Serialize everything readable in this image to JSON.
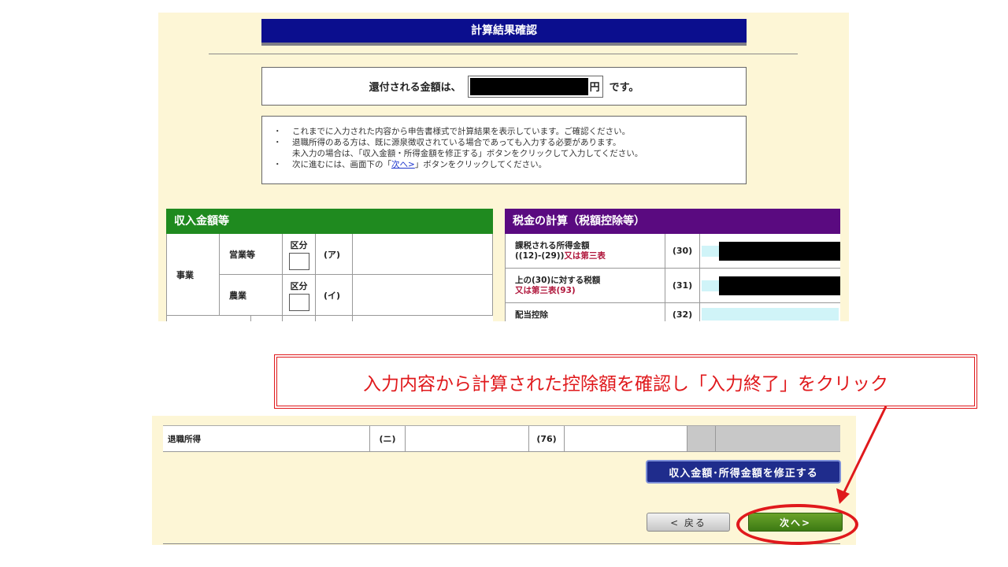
{
  "top_panel": {
    "title": "計算結果確認",
    "refund": {
      "prefix": "還付される金額は、",
      "unit": "円",
      "suffix": "です。"
    },
    "notes": [
      {
        "mark": "・",
        "text": "これまでに入力された内容から申告書様式で計算結果を表示しています。ご確認ください。"
      },
      {
        "mark": "・",
        "text": "退職所得のある方は、既に源泉徴収されている場合であっても入力する必要があります。"
      },
      {
        "mark": "",
        "text": "未入力の場合は、「収入金額・所得金額を修正する」ボタンをクリックして入力してください。"
      },
      {
        "mark": "・",
        "text_before": "次に進むには、画面下の「",
        "link": "次へ>",
        "text_after": "」ボタンをクリックしてください。"
      }
    ],
    "income_section": {
      "header": "収入金額等",
      "group_label": "事業",
      "rows": [
        {
          "label": "営業等",
          "kubun": "区分",
          "code": "(ア)"
        },
        {
          "label": "農業",
          "kubun": "区分",
          "code": "(イ)"
        }
      ]
    },
    "tax_section": {
      "header": "税金の計算（税額控除等）",
      "rows": [
        {
          "label": "課税される所得金額",
          "label2_plain": "((12)-(29))",
          "label2_red": "又は第三表",
          "code": "(30)"
        },
        {
          "label": "上の(30)に対する税額",
          "label2_plain": "",
          "label2_red": "又は第三表(93)",
          "code": "(31)"
        },
        {
          "label": "配当控除",
          "label2_plain": "",
          "label2_red": "",
          "code": "(32)"
        }
      ]
    }
  },
  "callout": {
    "text": "入力内容から計算された控除額を確認し「入力終了」をクリック"
  },
  "bottom_panel": {
    "row": {
      "label": "退職所得",
      "code1": "(ニ)",
      "code2": "(76)"
    },
    "fix_button": "収入金額･所得金額を修正する",
    "back_button": "< 戻る",
    "next_button": "次へ>"
  },
  "colors": {
    "title_bar": "#0b0e8e",
    "income_header": "#1f8a1f",
    "tax_header": "#5a0a80",
    "annotation_red": "#e0191c",
    "next_button": "#4a8a1c",
    "panel_bg": "#fdf6d6"
  }
}
